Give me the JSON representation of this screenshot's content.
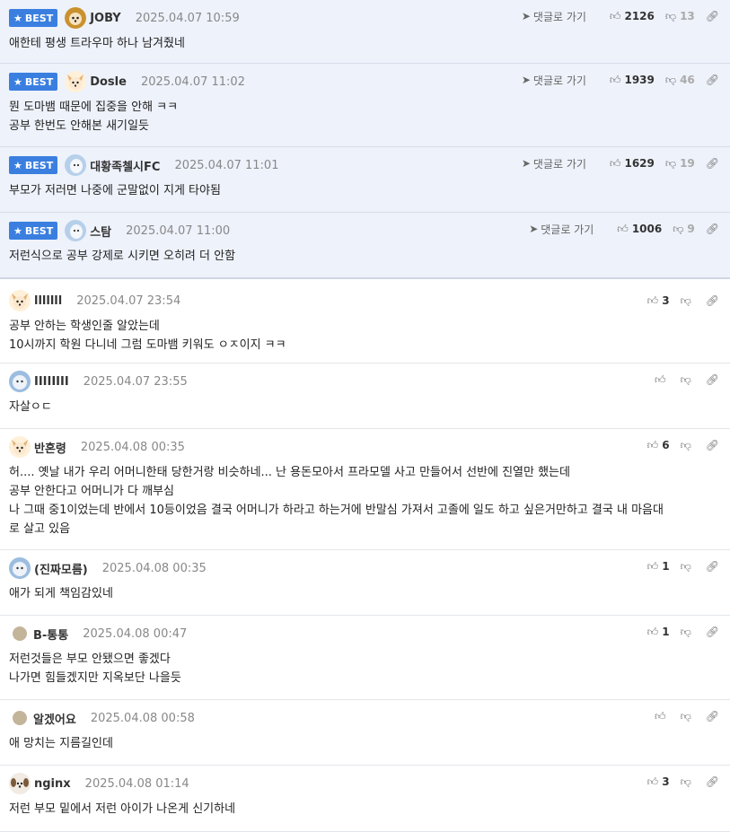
{
  "best_label": "BEST",
  "reply_label": "댓글로 가기",
  "comments": [
    {
      "best": true,
      "nick": "JOBY",
      "date": "2025.04.07 10:59",
      "up": "2126",
      "down": "13",
      "text": "애한테 평생 트라우마 하나 남겨줬네"
    },
    {
      "best": true,
      "nick": "Dosle",
      "date": "2025.04.07 11:02",
      "up": "1939",
      "down": "46",
      "text": "뭔 도마뱀 때문에 집중을 안해 ㅋㅋ\n공부 한번도 안해본 새기일듯"
    },
    {
      "best": true,
      "nick": "대황족첼시FC",
      "date": "2025.04.07 11:01",
      "up": "1629",
      "down": "19",
      "text": "부모가 저러면 나중에 군말없이 지게 타야됨"
    },
    {
      "best": true,
      "nick": "스탐",
      "date": "2025.04.07 11:00",
      "up": "1006",
      "down": "9",
      "text": "저런식으로 공부 강제로 시키면 오히려 더 안함"
    },
    {
      "best": false,
      "nick": "lllllll",
      "date": "2025.04.07 23:54",
      "up": "3",
      "down": "",
      "text": "공부 안하는 학생인줄 알았는데\n10시까지 학원 다니네 그럼 도마뱀 키워도 ㅇㅈ이지 ㅋㅋ"
    },
    {
      "best": false,
      "nick": "IIIIIIII",
      "date": "2025.04.07 23:55",
      "up": "",
      "down": "",
      "text": "자살ㅇㄷ"
    },
    {
      "best": false,
      "nick": "반혼령",
      "date": "2025.04.08 00:35",
      "up": "6",
      "down": "",
      "text": "허.... 옛날 내가 우리 어머니한태 당한거랑 비슷하네... 난 용돈모아서 프라모델 사고 만들어서 선반에 진열만 했는데\n공부 안한다고 어머니가 다 깨부심\n나 그때 중1이었는데 반에서 10등이었음 결국 어머니가 하라고 하는거에 반말심 가져서 고졸에 일도 하고 싶은거만하고 결국 내 마음대\n로 살고 있음"
    },
    {
      "best": false,
      "nick": "(진짜모름)",
      "date": "2025.04.08 00:35",
      "up": "1",
      "down": "",
      "text": "애가 되게 책임감있네"
    },
    {
      "best": false,
      "nick": "B-통통",
      "date": "2025.04.08 00:47",
      "up": "1",
      "down": "",
      "text": "저런것들은 부모 안됐으면 좋겠다\n나가면 힘들겠지만 지옥보단 나을듯"
    },
    {
      "best": false,
      "nick": "알겠어요",
      "date": "2025.04.08 00:58",
      "up": "",
      "down": "",
      "text": "애 망치는 지름길인데"
    },
    {
      "best": false,
      "nick": "nginx",
      "date": "2025.04.08 01:14",
      "up": "3",
      "down": "",
      "text": "저런 부모 밑에서 저런 아이가 나온게 신기하네"
    }
  ]
}
